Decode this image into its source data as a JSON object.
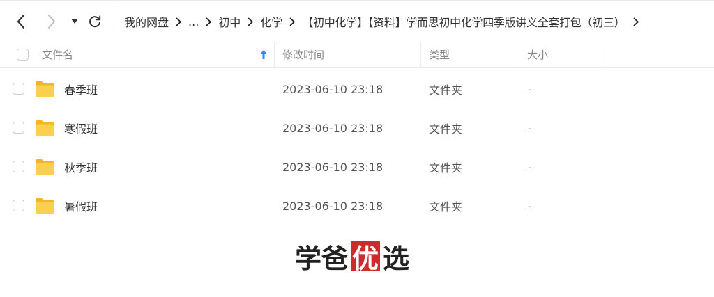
{
  "breadcrumb": {
    "items": [
      "我的网盘",
      "...",
      "初中",
      "化学",
      "【初中化学】【资料】学而思初中化学四季版讲义全套打包（初三）"
    ]
  },
  "table": {
    "columns": [
      "文件名",
      "修改时间",
      "类型",
      "大小"
    ],
    "rows": [
      {
        "name": "春季班",
        "modified": "2023-06-10 23:18",
        "type": "文件夹",
        "size": "-"
      },
      {
        "name": "寒假班",
        "modified": "2023-06-10 23:18",
        "type": "文件夹",
        "size": "-"
      },
      {
        "name": "秋季班",
        "modified": "2023-06-10 23:18",
        "type": "文件夹",
        "size": "-"
      },
      {
        "name": "暑假班",
        "modified": "2023-06-10 23:18",
        "type": "文件夹",
        "size": "-"
      }
    ]
  },
  "watermark": {
    "part1": "学爸",
    "highlight": "优",
    "part2": "选"
  },
  "icons": {
    "back": "chevron-left-icon",
    "forward": "chevron-right-icon",
    "dropdown": "caret-down-icon",
    "refresh": "refresh-icon",
    "sort": "sort-arrow-up-icon",
    "folder": "folder-icon"
  },
  "colors": {
    "folder": "#f9c23c",
    "sort_arrow": "#2b8cf0",
    "watermark_red": "#cf2b2b"
  }
}
